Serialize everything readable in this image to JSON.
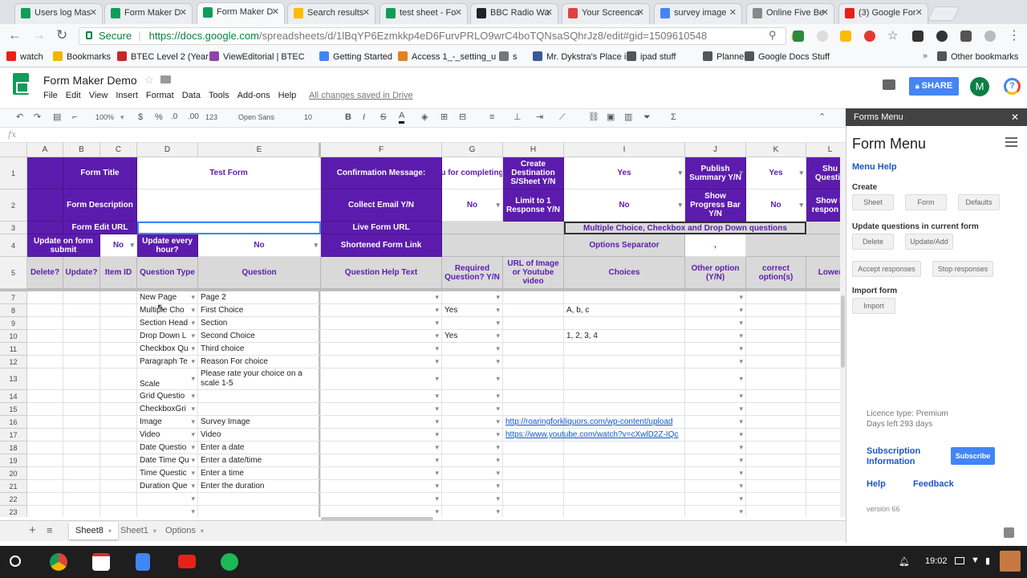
{
  "browser": {
    "tabs": [
      {
        "title": "Users log Mas",
        "color": "#0f9d58"
      },
      {
        "title": "Form Maker D",
        "color": "#0f9d58"
      },
      {
        "title": "Form Maker D",
        "color": "#0f9d58",
        "active": true
      },
      {
        "title": "Search results",
        "color": "#fbbc04"
      },
      {
        "title": "test sheet - Fo",
        "color": "#0f9d58"
      },
      {
        "title": "BBC Radio Wa",
        "color": "#222222"
      },
      {
        "title": "Your Screenca",
        "color": "#e04040"
      },
      {
        "title": "survey image",
        "color": "#4285f4"
      },
      {
        "title": "Online Five Be",
        "color": "#888888"
      },
      {
        "title": "(3) Google For",
        "color": "#e62117"
      }
    ],
    "secure_label": "Secure",
    "url_host": "https://docs.google.com",
    "url_path": "/spreadsheets/d/1lBqYP6Ezmkkp4eD6FurvPRLO9wrC4boTQNsaSQhrJz8/edit#gid=1509610548",
    "bookmarks": [
      "watch",
      "Bookmarks",
      "BTEC Level 2 (Year 1",
      "ViewEditorial | BTEC",
      "Getting Started",
      "Access 1_-_setting_u",
      "s",
      "Mr. Dykstra's Place i",
      "ipad stuff",
      "Planners",
      "Google Docs Stuff"
    ],
    "other_bookmarks": "Other bookmarks",
    "more_bookmarks": "»"
  },
  "doc": {
    "title": "Form Maker Demo",
    "menus": [
      "File",
      "Edit",
      "View",
      "Insert",
      "Format",
      "Data",
      "Tools",
      "Add-ons",
      "Help"
    ],
    "saved_status": "All changes saved in Drive",
    "share_label": "SHARE",
    "avatar_letter": "M"
  },
  "toolbar": {
    "zoom": "100%",
    "currency": "$",
    "percent": "%",
    "dec_less": ".0",
    "dec_more": ".00",
    "number_format": "123",
    "font": "Open Sans",
    "font_size": "10",
    "bold": "B",
    "italic": "I",
    "strike": "S",
    "text_color": "A",
    "functions": "Σ"
  },
  "formula_bar": {
    "fx": "fx",
    "value": ""
  },
  "columns": [
    "A",
    "B",
    "C",
    "D",
    "E",
    "F",
    "G",
    "H",
    "I",
    "J",
    "K",
    "L"
  ],
  "header_rows": {
    "r1": {
      "form_title_label": "Form Title",
      "form_title_value": "Test Form",
      "confirm_label": "Confirmation Message:",
      "confirm_value": "u for completing",
      "dest_label": "Create Destination S/Sheet Y/N",
      "dest_value": "Yes",
      "publish_label": "Publish Summary Y/N",
      "publish_value": "Yes",
      "shuffle_label": "Shu Questio"
    },
    "r2": {
      "desc_label": "Form Description",
      "email_label": "Collect Email Y/N",
      "email_value": "No",
      "limit_label": "Limit to 1 Response Y/N",
      "limit_value": "No",
      "progress_label": "Show Progress Bar Y/N",
      "progress_value": "No",
      "show_label": "Show L respon Y/"
    },
    "r3": {
      "edit_url_label": "Form Edit URL",
      "live_url_label": "Live Form URL",
      "mc_label": "Multiple Choice, Checkbox and Drop Down questions"
    },
    "r4": {
      "update_submit_label": "Update on form submit",
      "update_submit_value": "No",
      "update_hourly_label": "Update every hour?",
      "update_hourly_value": "No",
      "short_link_label": "Shortened Form Link",
      "options_sep_label": "Options Separator",
      "options_sep_value": ","
    },
    "r5": {
      "delete": "Delete?",
      "update": "Update?",
      "item_id": "Item ID",
      "qtype": "Question Type",
      "question": "Question",
      "help": "Question Help Text",
      "required": "Required Question? Y/N",
      "media": "URL of Image or Youtube video",
      "choices": "Choices",
      "other": "Other option (Y/N)",
      "correct": "correct option(s)",
      "lower": "Lower"
    }
  },
  "rows": [
    {
      "n": "7",
      "type": "New Page",
      "q": "Page 2",
      "req": "",
      "media": "",
      "choices": ""
    },
    {
      "n": "8",
      "type": "Multiple Cho",
      "q": "First Choice",
      "req": "Yes",
      "media": "",
      "choices": "A, b, c"
    },
    {
      "n": "9",
      "type": "Section Head",
      "q": "Section",
      "req": "",
      "media": "",
      "choices": ""
    },
    {
      "n": "10",
      "type": "Drop Down L",
      "q": "Second Choice",
      "req": "Yes",
      "media": "",
      "choices": "1, 2, 3, 4"
    },
    {
      "n": "11",
      "type": "Checkbox Qu",
      "q": "Third choice",
      "req": "",
      "media": "",
      "choices": ""
    },
    {
      "n": "12",
      "type": "Paragraph Te",
      "q": "Reason For choice",
      "req": "",
      "media": "",
      "choices": ""
    },
    {
      "n": "13",
      "type": "Scale Questic",
      "q": "Please rate your choice on a scale 1-5",
      "req": "",
      "media": "",
      "choices": "",
      "tall": true
    },
    {
      "n": "14",
      "type": "Grid Questio",
      "q": "",
      "req": "",
      "media": "",
      "choices": ""
    },
    {
      "n": "15",
      "type": "CheckboxGri",
      "q": "",
      "req": "",
      "media": "",
      "choices": ""
    },
    {
      "n": "16",
      "type": "Image",
      "q": "Survey Image",
      "req": "",
      "media": "http://roaringforkliquors.com/wp-content/upload",
      "choices": ""
    },
    {
      "n": "17",
      "type": "Video",
      "q": "Video",
      "req": "",
      "media": "https://www.youtube.com/watch?v=cXwlD2Z-IQc",
      "choices": ""
    },
    {
      "n": "18",
      "type": "Date Questio",
      "q": "Enter a date",
      "req": "",
      "media": "",
      "choices": ""
    },
    {
      "n": "19",
      "type": "Date Time Qu",
      "q": "Enter a date/time",
      "req": "",
      "media": "",
      "choices": ""
    },
    {
      "n": "20",
      "type": "Time Questic",
      "q": "Enter a time",
      "req": "",
      "media": "",
      "choices": ""
    },
    {
      "n": "21",
      "type": "Duration Que",
      "q": "Enter the duration",
      "req": "",
      "media": "",
      "choices": ""
    },
    {
      "n": "22",
      "type": "",
      "q": "",
      "req": "",
      "media": "",
      "choices": ""
    },
    {
      "n": "23",
      "type": "",
      "q": "",
      "req": "",
      "media": "",
      "choices": ""
    }
  ],
  "sheets": {
    "add": "+",
    "list": "≡",
    "tabs": [
      "Sheet8",
      "Sheet1",
      "Options"
    ],
    "active": "Sheet8"
  },
  "panel": {
    "header": "Forms Menu",
    "close": "✕",
    "title": "Form Menu",
    "menu_help": "Menu Help",
    "create_label": "Create",
    "create_buttons": [
      "Sheet",
      "Form",
      "Defaults"
    ],
    "update_label": "Update questions in current form",
    "update_buttons": [
      "Delete",
      "Update/Add"
    ],
    "response_buttons": [
      "Accept responses",
      "Stop responses"
    ],
    "import_label": "Import form",
    "import_button": "Import",
    "licence": "Licence type: Premium",
    "days_left": "Days left 293 days",
    "subscription_info": "Subscription Information",
    "subscribe": "Subscribe",
    "help": "Help",
    "feedback": "Feedback",
    "version": "version 66"
  },
  "taskbar": {
    "time": "19:02",
    "apps": [
      "chrome",
      "gmail",
      "docs",
      "youtube",
      "spotify"
    ]
  },
  "colors": {
    "purple": "#5b1cad",
    "accent_blue": "#4285f4",
    "sheets_green": "#0f9d58"
  }
}
